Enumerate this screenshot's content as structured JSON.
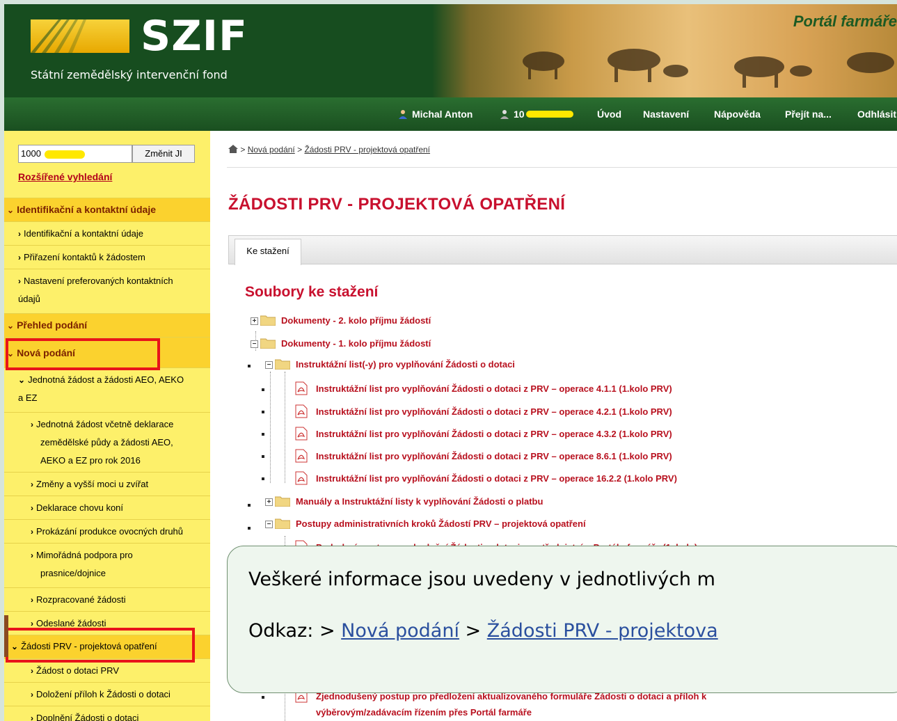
{
  "header": {
    "logo_text": "SZIF",
    "logo_subtitle": "Státní zemědělský intervenční fond",
    "portal_title": "Portál farmáře"
  },
  "topnav": {
    "user_name": "Michal Anton",
    "user_id": "10",
    "items": [
      "Úvod",
      "Nastavení",
      "Nápověda",
      "Přejít na...",
      "Odhlásit"
    ]
  },
  "sidebar": {
    "search_value": "1000",
    "change_button": "Změnit JI",
    "advanced_search": "Rozšířené vyhledání",
    "sections": {
      "identification": "Identifikační a kontaktní údaje",
      "overview": "Přehled podání",
      "new": "Nová podání"
    },
    "items": {
      "ident": "Identifikační a kontaktní údaje",
      "assign": "Přiřazení kontaktů k žádostem",
      "prefs_1": "Nastavení preferovaných kontaktních",
      "prefs_2": "údajů",
      "unified_1": "Jednotná žádost a žádosti AEO, AEKO",
      "unified_2": "a EZ",
      "unified_2016_1": "Jednotná žádost včetně deklarace",
      "unified_2016_2": "zemědělské půdy a žádosti AEO,",
      "unified_2016_3": "AEKO a EZ pro rok 2016",
      "changes": "Změny a vyšší moci u zvířat",
      "horses": "Deklarace chovu koní",
      "fruit": "Prokázání produkce ovocných druhů",
      "sows_1": "Mimořádná podpora pro",
      "sows_2": "prasnice/dojnice",
      "in_progress": "Rozpracované žádosti",
      "sent": "Odeslané žádosti",
      "prv": "Žádosti PRV - projektová opatření",
      "prv_grant": "Žádost o dotaci PRV",
      "prv_attach": "Doložení příloh k Žádosti o dotaci",
      "prv_supplement": "Doplnění Žádosti o dotaci"
    }
  },
  "main": {
    "breadcrumb": {
      "sep": ">",
      "link1": "Nová podání",
      "link2": "Žádosti PRV - projektová opatření"
    },
    "page_title": "ŽÁDOSTI PRV - PROJEKTOVÁ OPATŘENÍ",
    "tab_label": "Ke stažení",
    "files_title": "Soubory ke stažení",
    "tree": {
      "docs_round2": "Dokumenty - 2. kolo příjmu žádostí",
      "docs_round1": "Dokumenty - 1. kolo příjmu žádostí",
      "instr_folder": "Instruktážní list(-y) pro vyplňování Žádosti o dotaci",
      "pdf_411": "Instruktážní list pro vyplňování Žádosti o dotaci z PRV – operace 4.1.1 (1.kolo PRV)",
      "pdf_421": "Instruktážní list pro vyplňování Žádosti o dotaci z PRV – operace 4.2.1 (1.kolo PRV)",
      "pdf_432": "Instruktážní list pro vyplňování Žádosti o dotaci z PRV – operace 4.3.2 (1.kolo PRV)",
      "pdf_861": "Instruktážní list pro vyplňování Žádosti o dotaci z PRV – operace 8.6.1 (1.kolo PRV)",
      "pdf_1622": "Instruktážní list pro vyplňování Žádosti o dotaci z PRV – operace 16.2.2 (1.kolo PRV)",
      "manuals": "Manuály a Instruktážní listy k vyplňování Žádosti o platbu",
      "procedures": "Postupy administrativních kroků Žádostí PRV – projektová opatření",
      "detail_proc": "Podrobný postup pro doplnění Žádosti o dotaci prostřednictvím Portálu farmáře (1. kolo)",
      "simple_proc": "Zjednodušený postup pro předložení aktualizovaného formuláře Žádosti o dotaci a příloh k",
      "simple_proc_2": "výběrovým/zadávacím řízením přes Portál farmáře"
    }
  },
  "callout": {
    "text": "Veškeré informace jsou uvedeny v jednotlivých m",
    "link_prefix": "Odkaz: >",
    "link1": "Nová podání",
    "sep": ">",
    "link2": "Žádosti PRV - projektova"
  },
  "colors": {
    "header_green": "#174d1f",
    "sidebar_yellow": "#fdf06a",
    "section_yellow": "#fbd22e",
    "title_red": "#c8102e",
    "highlight_red": "#e8141a"
  }
}
